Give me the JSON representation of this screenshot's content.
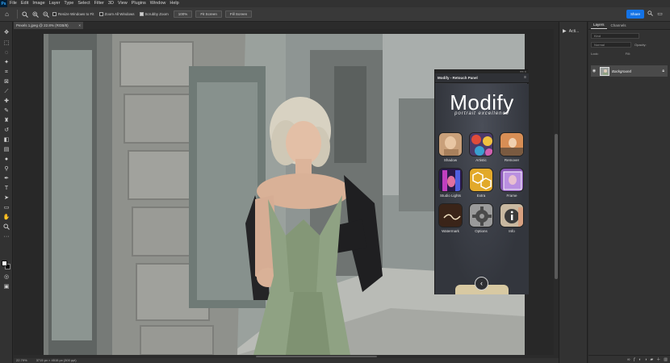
{
  "app": {
    "logo": "Ps",
    "menu": [
      "File",
      "Edit",
      "Image",
      "Layer",
      "Type",
      "Select",
      "Filter",
      "3D",
      "View",
      "Plugins",
      "Window",
      "Help"
    ]
  },
  "options_bar": {
    "resize_windows": "Resize Windows to Fit",
    "zoom_all": "Zoom All Windows",
    "scrubby_zoom": "Scrubby Zoom",
    "zoom_100": "100%",
    "fit_screen": "Fit Screen",
    "fill_screen": "Fill Screen",
    "share": "Share"
  },
  "document": {
    "tab_title": "Pexels 1.jpeg @ 22.8% (RGB/8)",
    "tab_close": "×"
  },
  "status": {
    "zoom": "22.79%",
    "dimensions": "3715 px × 4515 px (300 ppi)"
  },
  "actions_panel": {
    "label": "Acti..."
  },
  "layers_panel": {
    "tabs": [
      "Layers",
      "Channels"
    ],
    "kind_placeholder": "Kind",
    "blend_mode": "Normal",
    "opacity_label": "Opacity:",
    "lock_label": "Lock:",
    "fill_label": "Fill:",
    "layer_name": "Background"
  },
  "modify_panel": {
    "title": "Modify - Retouch Panel",
    "logo": "Modify",
    "subtitle": "portrait excellence",
    "tools": [
      {
        "label": "Shadow"
      },
      {
        "label": "Artistic"
      },
      {
        "label": "Remover"
      },
      {
        "label": "Studio Lights"
      },
      {
        "label": "Extra"
      },
      {
        "label": "Frame"
      },
      {
        "label": "Watermark"
      },
      {
        "label": "Options"
      },
      {
        "label": "Info"
      }
    ],
    "back_glyph": "‹"
  },
  "colors": {
    "accent": "#1473e6",
    "panel_bg": "#323232",
    "canvas_bg": "#282828",
    "dress_green": "#8fa283"
  }
}
